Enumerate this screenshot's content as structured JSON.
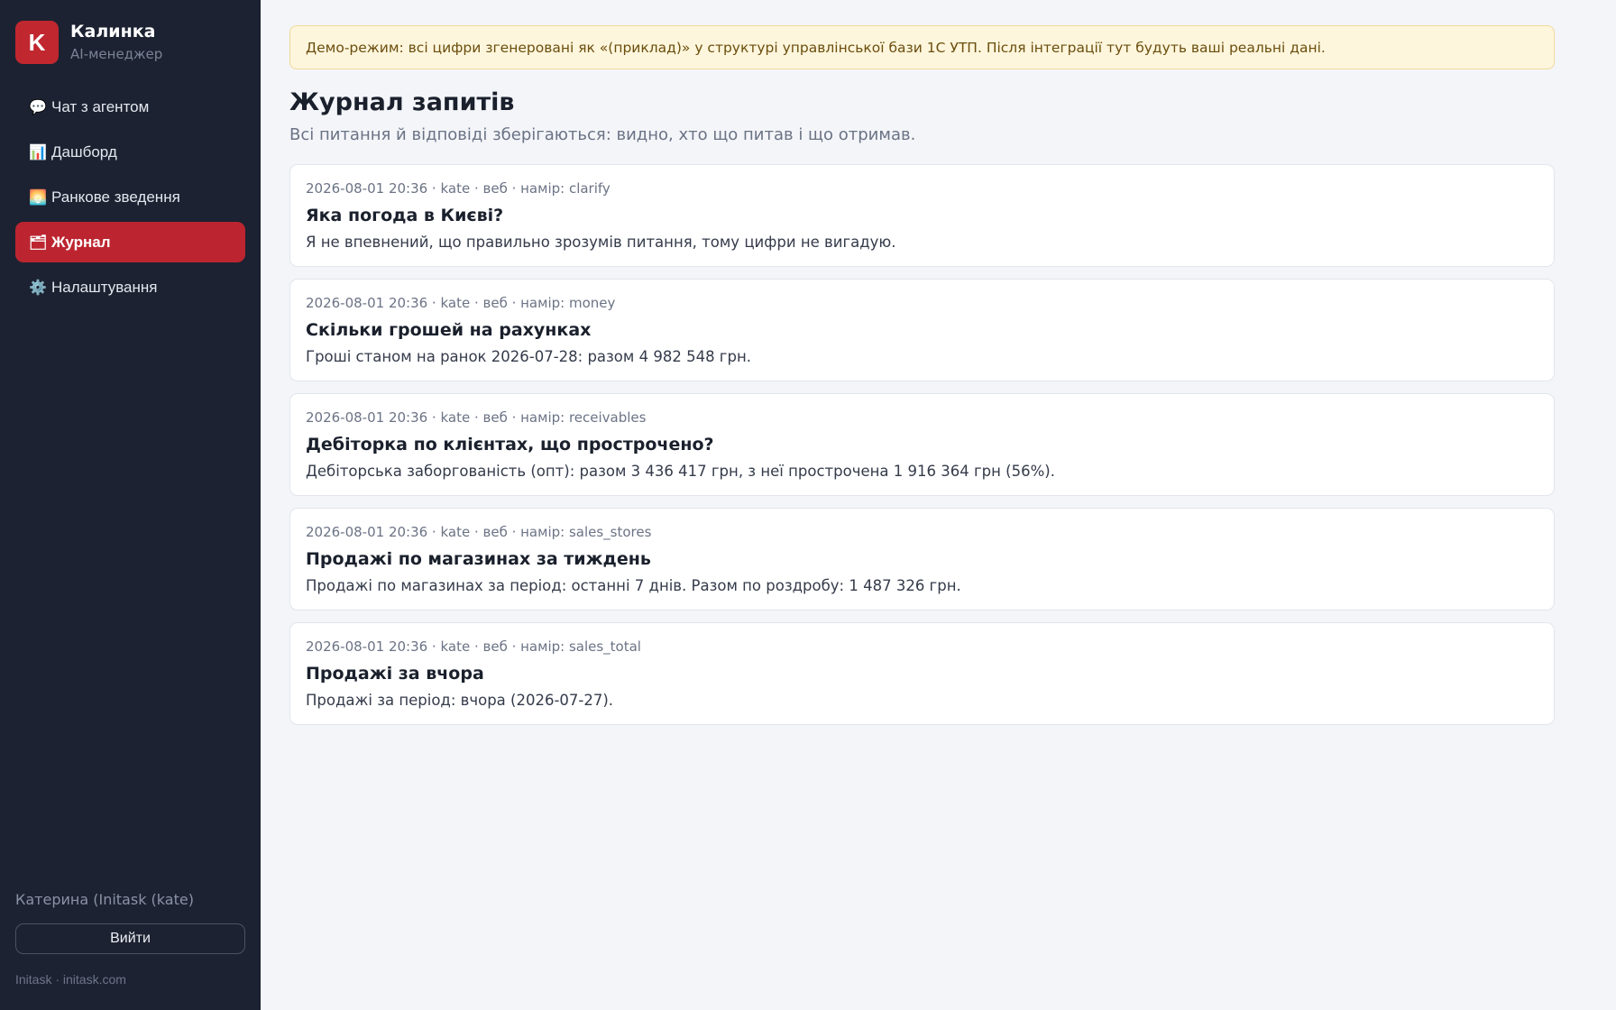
{
  "brand": {
    "logo_letter": "K",
    "name": "Калинка",
    "subtitle": "AI-менеджер"
  },
  "nav": {
    "items": [
      {
        "icon": "💬",
        "label": "Чат з агентом",
        "active": false
      },
      {
        "icon": "📊",
        "label": "Дашборд",
        "active": false
      },
      {
        "icon": "🌅",
        "label": "Ранкове зведення",
        "active": false
      },
      {
        "icon": "🗂",
        "label": "Журнал",
        "active": true
      },
      {
        "icon": "⚙️",
        "label": "Налаштування",
        "active": false
      }
    ]
  },
  "user": {
    "name": "Катерина (Initask (kate)",
    "logout_label": "Вийти"
  },
  "footer": {
    "text": "Initask · initask.com"
  },
  "banner": {
    "text": "Демо-режим: всі цифри згенеровані як «(приклад)» у структурі управлінської бази 1С УТП. Після інтеграції тут будуть ваші реальні дані."
  },
  "page": {
    "title": "Журнал запитів",
    "subtitle": "Всі питання й відповіді зберігаються: видно, хто що питав і що отримав."
  },
  "log": [
    {
      "meta": "2026-08-01 20:36 · kate · веб · намір: clarify",
      "question": "Яка погода в Києві?",
      "answer": "Я не впевнений, що правильно зрозумів питання, тому цифри не вигадую."
    },
    {
      "meta": "2026-08-01 20:36 · kate · веб · намір: money",
      "question": "Скільки грошей на рахунках",
      "answer": "Гроші станом на ранок 2026-07-28: разом 4 982 548 грн."
    },
    {
      "meta": "2026-08-01 20:36 · kate · веб · намір: receivables",
      "question": "Дебіторка по клієнтах, що прострочено?",
      "answer": "Дебіторська заборгованість (опт): разом 3 436 417 грн, з неї прострочена 1 916 364 грн (56%)."
    },
    {
      "meta": "2026-08-01 20:36 · kate · веб · намір: sales_stores",
      "question": "Продажі по магазинах за тиждень",
      "answer": "Продажі по магазинах за період: останні 7 днів. Разом по роздробу: 1 487 326 грн."
    },
    {
      "meta": "2026-08-01 20:36 · kate · веб · намір: sales_total",
      "question": "Продажі за вчора",
      "answer": "Продажі за період: вчора (2026-07-27)."
    }
  ],
  "colors": {
    "sidebar_bg": "#1c2231",
    "accent": "#bc2530",
    "banner_bg": "#fef6dc",
    "page_bg": "#f4f5f9"
  }
}
